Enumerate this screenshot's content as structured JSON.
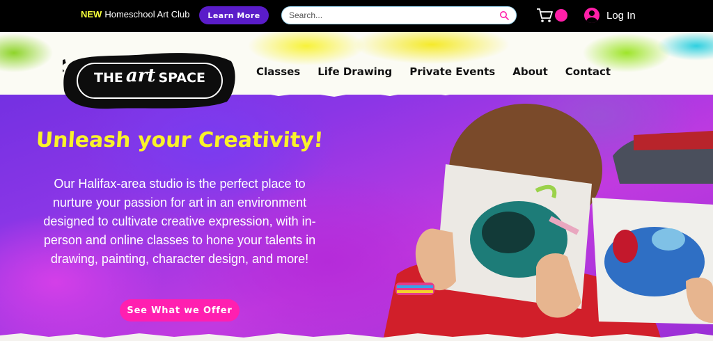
{
  "topbar": {
    "promo_new": "NEW",
    "promo_text": "Homeschool Art Club",
    "learn_more": "Learn More",
    "search_placeholder": "Search...",
    "login": "Log In",
    "cart_icon": "cart-icon",
    "search_icon": "search-icon",
    "avatar_icon": "user-avatar-icon"
  },
  "logo": {
    "word1": "THE",
    "word2": "art",
    "word3": "SPACE"
  },
  "nav": [
    {
      "label": "Classes"
    },
    {
      "label": "Life Drawing"
    },
    {
      "label": "Private Events"
    },
    {
      "label": "About"
    },
    {
      "label": "Contact"
    }
  ],
  "hero": {
    "headline": "Unleash your Creativity!",
    "body": "Our Halifax-area studio is the perfect place to nurture your passion for art in an environment designed to cultivate creative expression, with in-person and online classes to hone your talents in drawing, painting, character design, and more!",
    "cta": "See What we Offer"
  },
  "colors": {
    "accent_pink": "#ff1fb0",
    "button_purple": "#5a1cc9",
    "headline_yellow": "#f9f22a",
    "hero_purple": "#8a36e6"
  }
}
